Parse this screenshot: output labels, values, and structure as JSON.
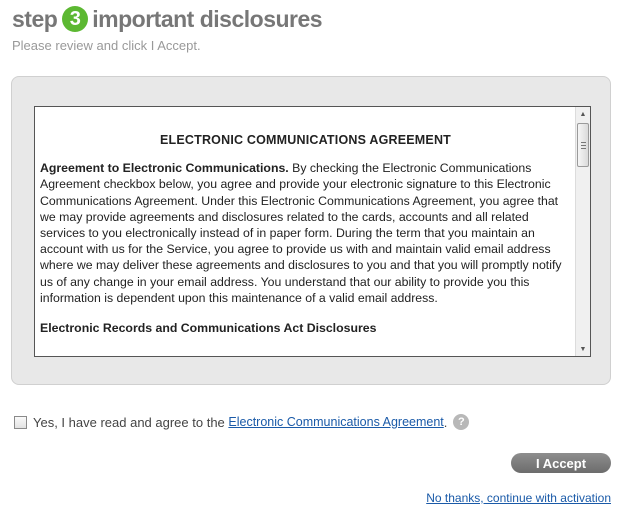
{
  "header": {
    "step_label": "step",
    "step_number": "3",
    "title": "important disclosures",
    "subtitle": "Please review and click I Accept."
  },
  "agreement": {
    "title": "ELECTRONIC COMMUNICATIONS AGREEMENT",
    "para1_heading": "Agreement to Electronic Communications.",
    "para1_body": " By checking the Electronic Communications Agreement checkbox below, you agree and provide your electronic signature to this Electronic Communications Agreement. Under this Electronic Communications Agreement, you agree that we may provide agreements and disclosures related to the cards, accounts and all related services to you electronically instead of in paper form. During the term that you maintain an account with us for the Service, you agree to provide us with and maintain valid email address where we may deliver these agreements and disclosures to you and that you will promptly notify us of any change in your email address. You understand that our ability to provide you this information is dependent upon this maintenance of a valid email address.",
    "section2_heading": "Electronic Records and Communications Act Disclosures"
  },
  "consent": {
    "checkbox_checked": false,
    "label_prefix": "Yes, I have read and agree to the ",
    "link_text": "Electronic Communications Agreement",
    "label_suffix": ".",
    "help_icon": "question-icon"
  },
  "actions": {
    "accept_label": "I Accept",
    "no_thanks_label": "No thanks, continue with activation"
  },
  "colors": {
    "step_badge": "#5cb832",
    "link": "#1a5aa8",
    "accept_button": "#7a7a7a"
  }
}
